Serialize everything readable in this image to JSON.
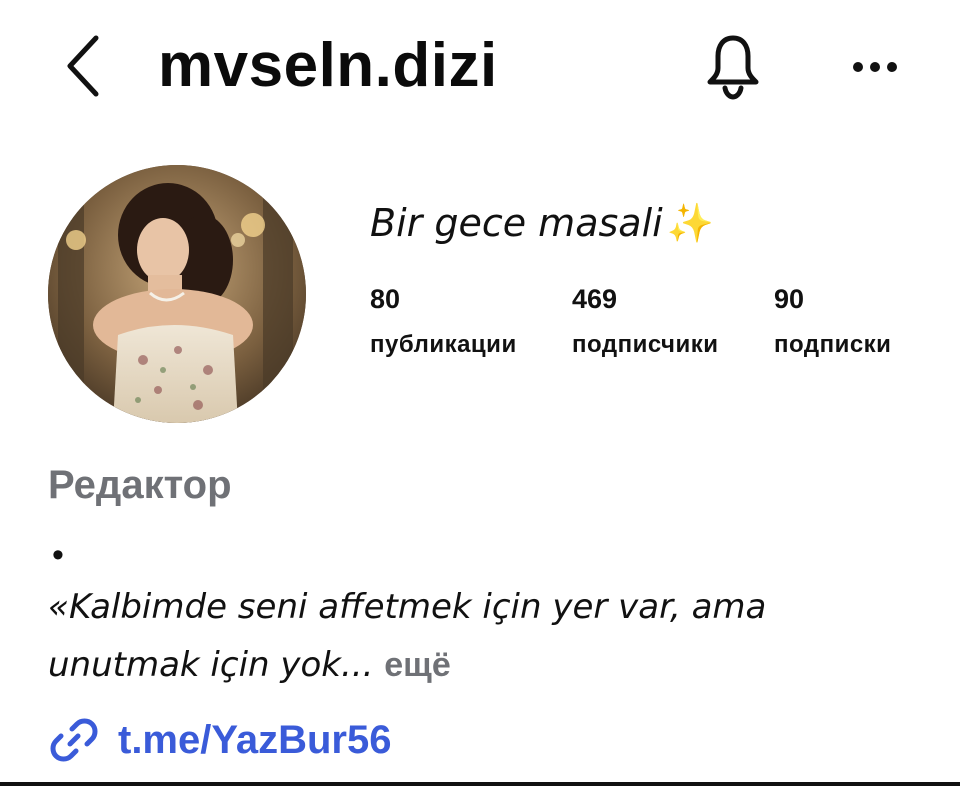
{
  "header": {
    "username": "mvseln.dizi",
    "back_icon": "chevron-left-icon",
    "bell_icon": "bell-icon",
    "more_icon": "ellipsis-icon"
  },
  "profile": {
    "display_name": "Bir gece masali",
    "display_name_emoji": "✨",
    "stats": {
      "posts": {
        "value": "80",
        "label": "публикации"
      },
      "followers": {
        "value": "469",
        "label": "подписчики"
      },
      "following": {
        "value": "90",
        "label": "подписки"
      }
    },
    "category": "Редактор",
    "bullet": "•",
    "bio_line1": "«Kalbimde seni affetmek için yer var, ama",
    "bio_line2": "unutmak için yok...",
    "bio_more": "ещё",
    "link": {
      "icon": "link-icon",
      "text": "t.me/YazBur56"
    }
  },
  "colors": {
    "link": "#3a5bd9",
    "muted": "#6f7176",
    "sparkle": "#f2c230"
  }
}
